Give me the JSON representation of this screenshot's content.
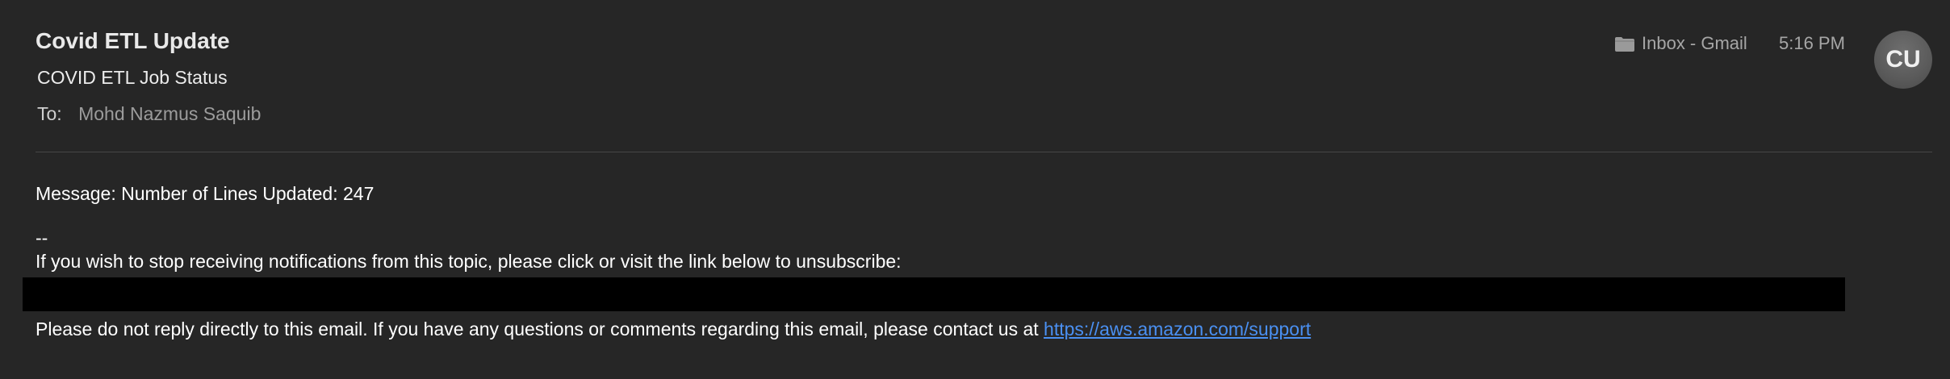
{
  "header": {
    "sender": "Covid ETL Update",
    "subject": "COVID ETL Job Status",
    "to_label": "To:",
    "to_value": "Mohd Nazmus Saquib",
    "mailbox": "Inbox - Gmail",
    "mailbox_icon": "folder-icon",
    "time": "5:16 PM",
    "avatar_initials": "CU"
  },
  "body": {
    "message": "Message: Number of Lines Updated: 247",
    "signature": "--",
    "unsubscribe_text": "If you wish to stop receiving notifications from this topic, please click or visit the link below to unsubscribe:",
    "footer_text": "Please do not reply directly to this email. If you have any questions or comments regarding this email, please contact us at ",
    "footer_link": "https://aws.amazon.com/support"
  },
  "colors": {
    "background": "#262626",
    "link": "#4a90f2",
    "redaction": "#000000"
  }
}
